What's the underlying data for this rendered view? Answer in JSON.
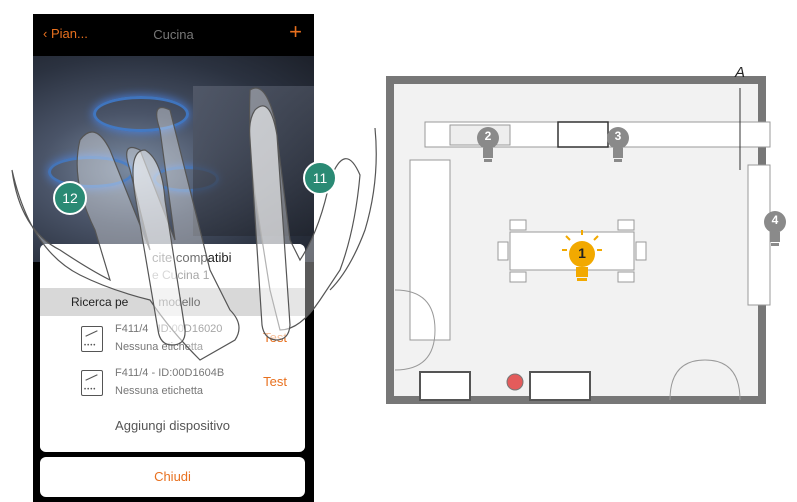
{
  "app": {
    "nav": {
      "back_label": "Pian...",
      "title": "Cucina",
      "add_label": "+"
    },
    "panel": {
      "title": "cite compatibi",
      "subtitle": "e Cucina 1",
      "search_label": "Ricerca pe         modello",
      "devices": [
        {
          "id": "F411/4   ID:00D16020",
          "label": "Nessuna etichetta",
          "action": "Test"
        },
        {
          "id": "F411/4 - ID:00D1604B",
          "label": "Nessuna etichetta",
          "action": "Test"
        }
      ],
      "add_label": "Aggiungi dispositivo"
    },
    "close_label": "Chiudi",
    "steps": {
      "left": "12",
      "right": "11"
    },
    "accent": "#e8701e",
    "step_color": "#2a8a74"
  },
  "plan": {
    "area_label": "A",
    "lights": [
      {
        "number": "1",
        "state": "on"
      },
      {
        "number": "2",
        "state": "off"
      },
      {
        "number": "3",
        "state": "off"
      },
      {
        "number": "4",
        "state": "off"
      }
    ],
    "on_color": "#f2a900",
    "off_color": "#8a8a8a"
  }
}
